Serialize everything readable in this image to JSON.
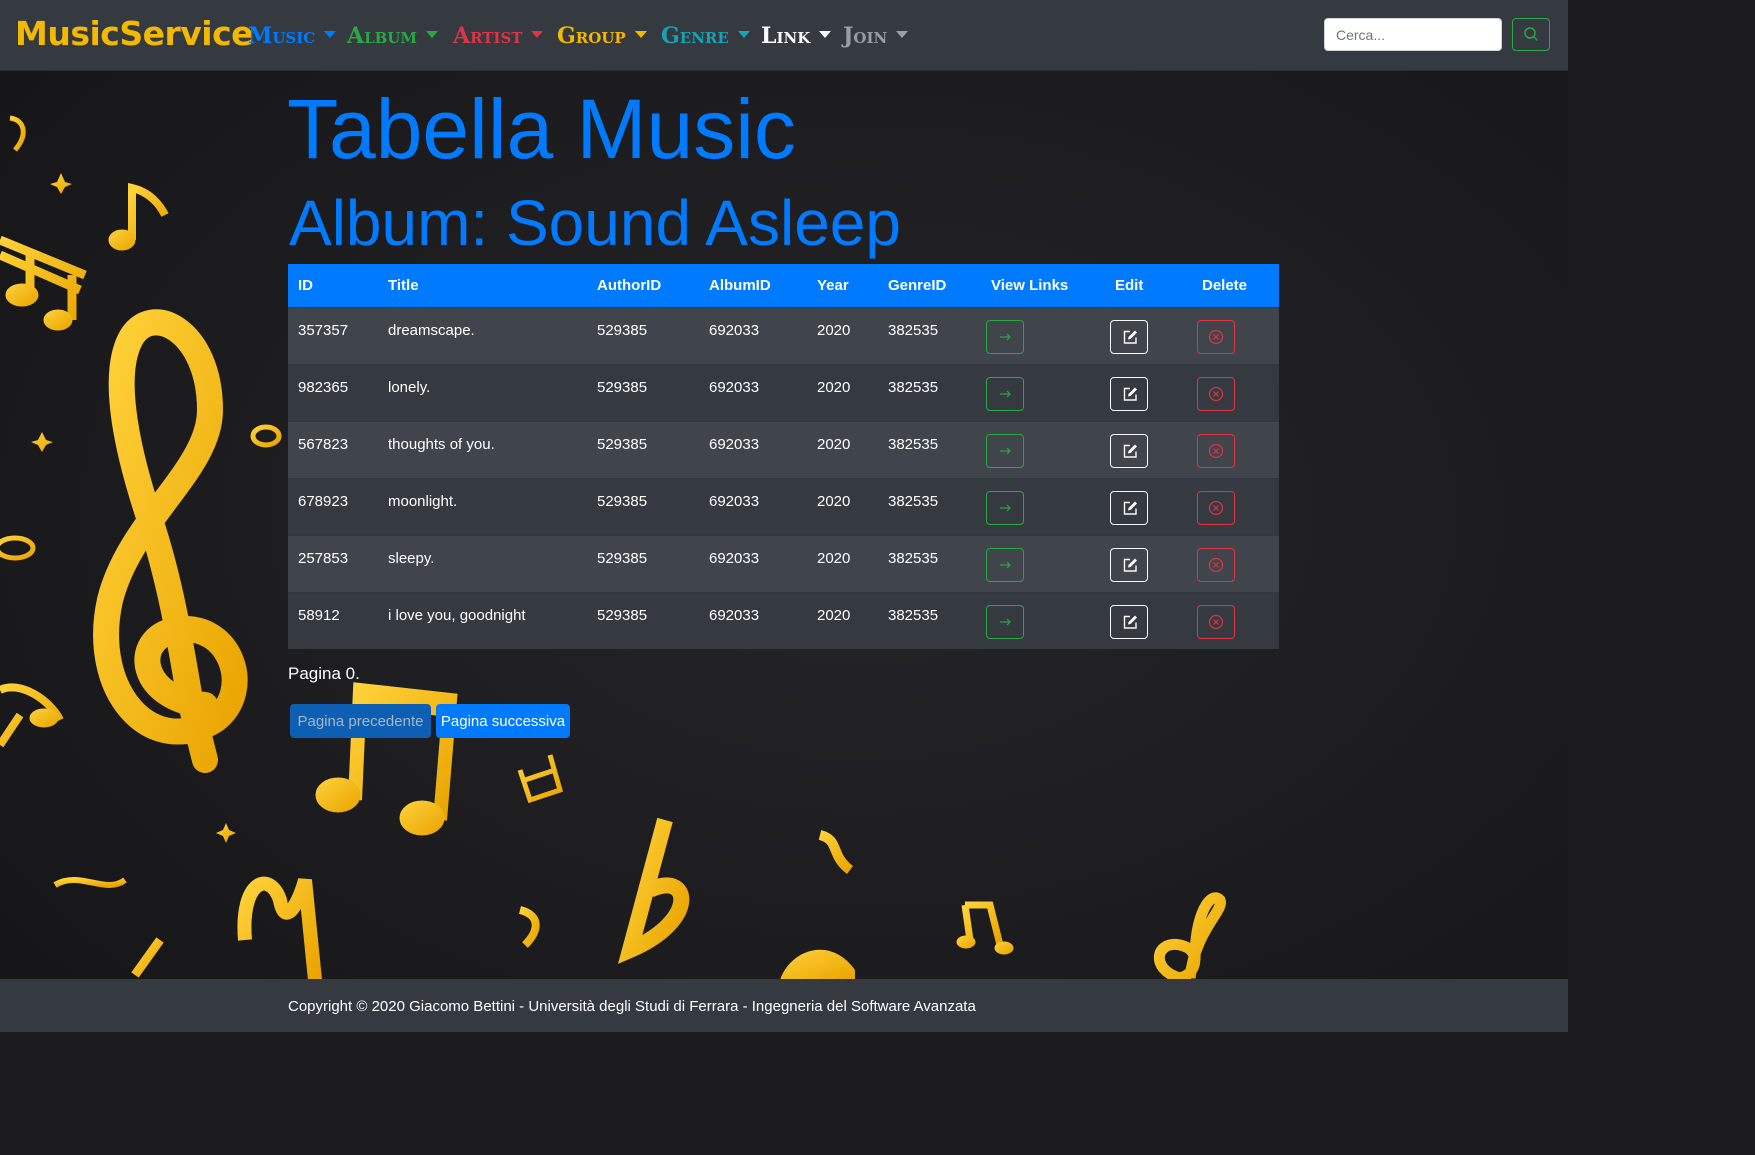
{
  "navbar": {
    "brand": "MusicService",
    "menus": [
      {
        "label": "Music",
        "color": "#007bff"
      },
      {
        "label": "Album",
        "color": "#28a745"
      },
      {
        "label": "Artist",
        "color": "#dc3545"
      },
      {
        "label": "Group",
        "color": "#f5b800"
      },
      {
        "label": "Genre",
        "color": "#17a2b8"
      },
      {
        "label": "Link",
        "color": "#f8f9fa"
      },
      {
        "label": "Join",
        "color": "#9a9ea3"
      }
    ],
    "search": {
      "placeholder": "Cerca...",
      "button_icon": "search-icon"
    }
  },
  "main": {
    "title": "Tabella Music",
    "subtitle": "Album: Sound Asleep",
    "table": {
      "headers": [
        "ID",
        "Title",
        "AuthorID",
        "AlbumID",
        "Year",
        "GenreID",
        "View Links",
        "Edit",
        "Delete"
      ],
      "rows": [
        {
          "id": "357357",
          "title": "dreamscape.",
          "author_id": "529385",
          "album_id": "692033",
          "year": "2020",
          "genre_id": "382535"
        },
        {
          "id": "982365",
          "title": "lonely.",
          "author_id": "529385",
          "album_id": "692033",
          "year": "2020",
          "genre_id": "382535"
        },
        {
          "id": "567823",
          "title": "thoughts of you.",
          "author_id": "529385",
          "album_id": "692033",
          "year": "2020",
          "genre_id": "382535"
        },
        {
          "id": "678923",
          "title": "moonlight.",
          "author_id": "529385",
          "album_id": "692033",
          "year": "2020",
          "genre_id": "382535"
        },
        {
          "id": "257853",
          "title": "sleepy.",
          "author_id": "529385",
          "album_id": "692033",
          "year": "2020",
          "genre_id": "382535"
        },
        {
          "id": "58912",
          "title": "i love you, goodnight",
          "author_id": "529385",
          "album_id": "692033",
          "year": "2020",
          "genre_id": "382535"
        }
      ],
      "action_icons": {
        "view": "arrow-right-icon",
        "edit": "pencil-square-icon",
        "delete": "x-circle-icon"
      }
    },
    "pagination": {
      "info": "Pagina 0.",
      "prev_label": "Pagina precedente",
      "next_label": "Pagina successiva"
    }
  },
  "footer": {
    "text": "Copyright © 2020 Giacomo Bettini - Università degli Studi di Ferrara - Ingegneria del Software Avanzata"
  },
  "theme": {
    "accent": "#007bff",
    "background": "#1b1b1d",
    "panel": "#343a40",
    "notes": "#f5b800"
  }
}
